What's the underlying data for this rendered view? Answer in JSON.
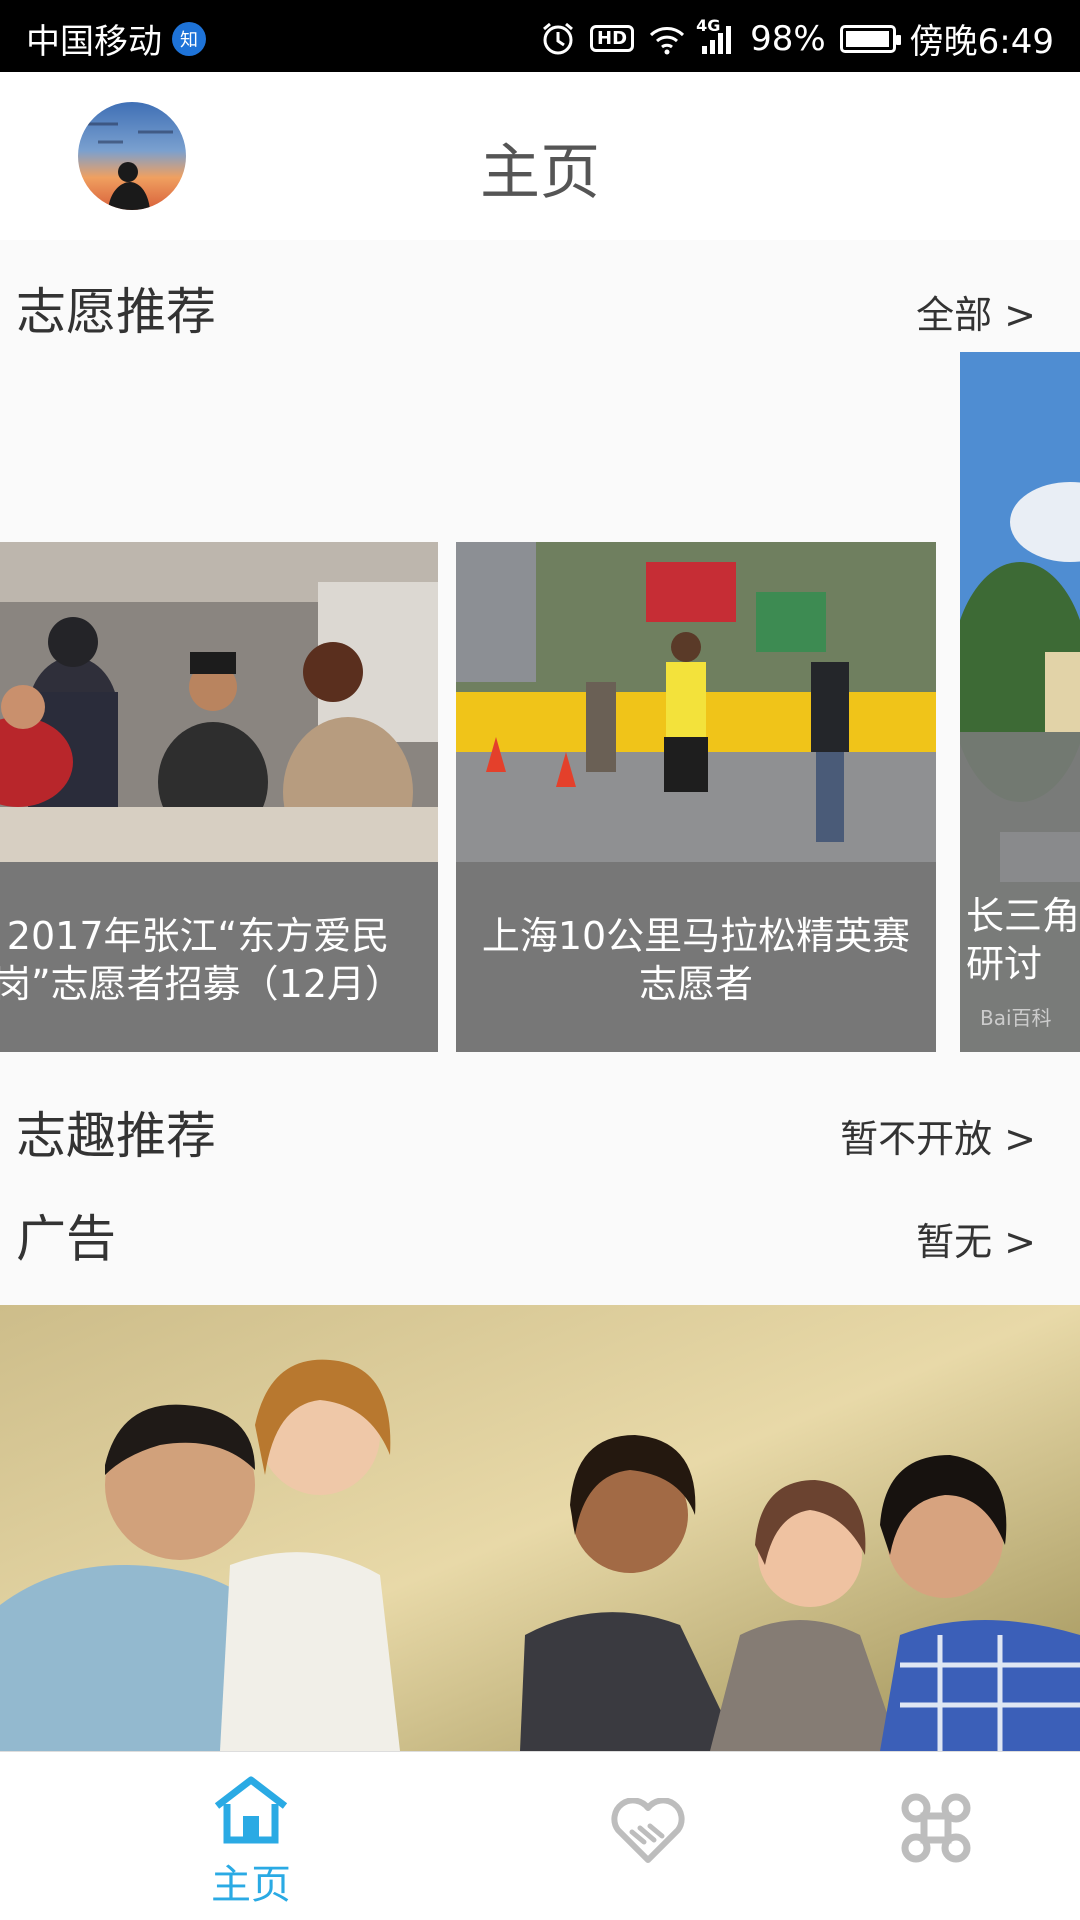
{
  "status_bar": {
    "carrier": "中国移动",
    "carrier_badge": "知",
    "hd": "HD",
    "network": "4G",
    "battery_percent": "98%",
    "battery_level": 0.98,
    "time": "傍晚6:49"
  },
  "header": {
    "title": "主页"
  },
  "volunteer_section": {
    "title": "志愿推荐",
    "more": "全部 >"
  },
  "cards": [
    {
      "caption": "2017年张江“东方爱民\n岗”志愿者招募（12月）"
    },
    {
      "caption": "上海10公里马拉松精英赛\n志愿者"
    },
    {
      "caption": "长三角\n研讨",
      "watermark": "Bai百科"
    }
  ],
  "interest_section": {
    "title": "志趣推荐",
    "more": "暂不开放 >"
  },
  "ads_section": {
    "title": "广告",
    "more": "暂无 >"
  },
  "tabbar": {
    "home_label": "主页",
    "home_color": "#2aaae4",
    "inactive_color": "#bdbdbd"
  }
}
